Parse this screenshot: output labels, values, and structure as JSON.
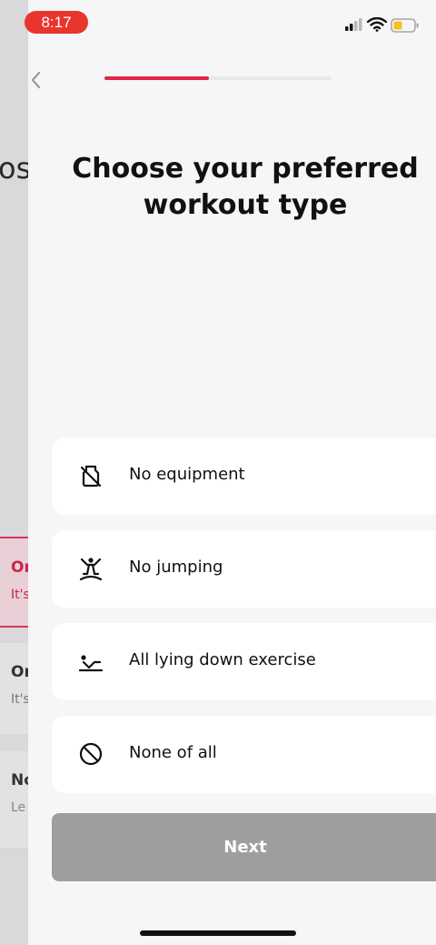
{
  "status_bar": {
    "time": "8:17"
  },
  "background_screen": {
    "title_fragment": "os",
    "cards": [
      {
        "line1": "Or",
        "line2": "It's"
      },
      {
        "line1": "Or",
        "line2": "It's"
      },
      {
        "line1": "No",
        "line2": "Le"
      }
    ]
  },
  "header": {
    "progress_fraction": 0.46
  },
  "main": {
    "title": "Choose your preferred workout type",
    "options": [
      {
        "label": "No equipment",
        "icon": "no-equipment-icon"
      },
      {
        "label": "No jumping",
        "icon": "no-jumping-icon"
      },
      {
        "label": "All lying down exercise",
        "icon": "lying-down-icon"
      },
      {
        "label": "None of all",
        "icon": "none-icon"
      }
    ],
    "next_label": "Next"
  },
  "colors": {
    "accent": "#e0254a",
    "button_disabled": "#9e9d9f",
    "status_time_bg": "#e8352e"
  }
}
